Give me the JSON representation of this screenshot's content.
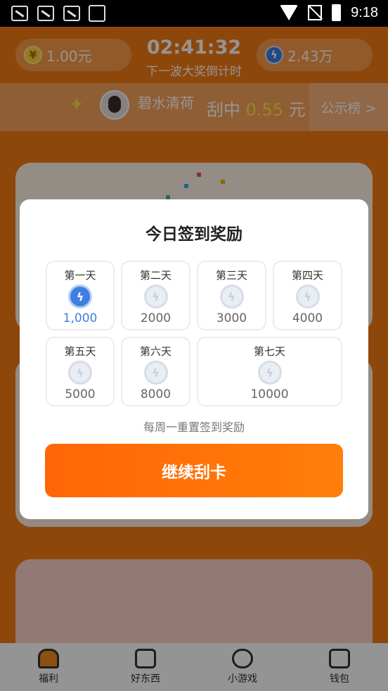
{
  "status_bar": {
    "time": "9:18"
  },
  "header": {
    "balance_yuan": "1.00元",
    "countdown": "02:41:32",
    "countdown_caption": "下一波大奖倒计时",
    "points": "2.43万"
  },
  "banner": {
    "username": "碧水清荷",
    "win_prefix": "刮中",
    "win_amount": "0.55",
    "win_suffix": "元",
    "leaderboard_link": "公示榜 >"
  },
  "dialog": {
    "title": "今日签到奖励",
    "days": [
      {
        "label": "第一天",
        "value": "1,000",
        "claimed": true
      },
      {
        "label": "第二天",
        "value": "2000",
        "claimed": false
      },
      {
        "label": "第三天",
        "value": "3000",
        "claimed": false
      },
      {
        "label": "第四天",
        "value": "4000",
        "claimed": false
      },
      {
        "label": "第五天",
        "value": "5000",
        "claimed": false
      },
      {
        "label": "第六天",
        "value": "8000",
        "claimed": false
      },
      {
        "label": "第七天",
        "value": "10000",
        "claimed": false
      }
    ],
    "note": "每周一重置签到奖励",
    "button": "继续刮卡"
  },
  "tabbar": {
    "tabs": [
      {
        "label": "福利",
        "icon": "home-icon",
        "active": true
      },
      {
        "label": "好东西",
        "icon": "shopping-bag-icon",
        "active": false
      },
      {
        "label": "小游戏",
        "icon": "gamepad-icon",
        "active": false
      },
      {
        "label": "钱包",
        "icon": "wallet-icon",
        "active": false
      }
    ]
  },
  "colors": {
    "brand_orange": "#f57a14",
    "cta_orange": "#ff6a06",
    "claimed_blue": "#3f7fe0",
    "highlight_yellow": "#ffe545"
  }
}
